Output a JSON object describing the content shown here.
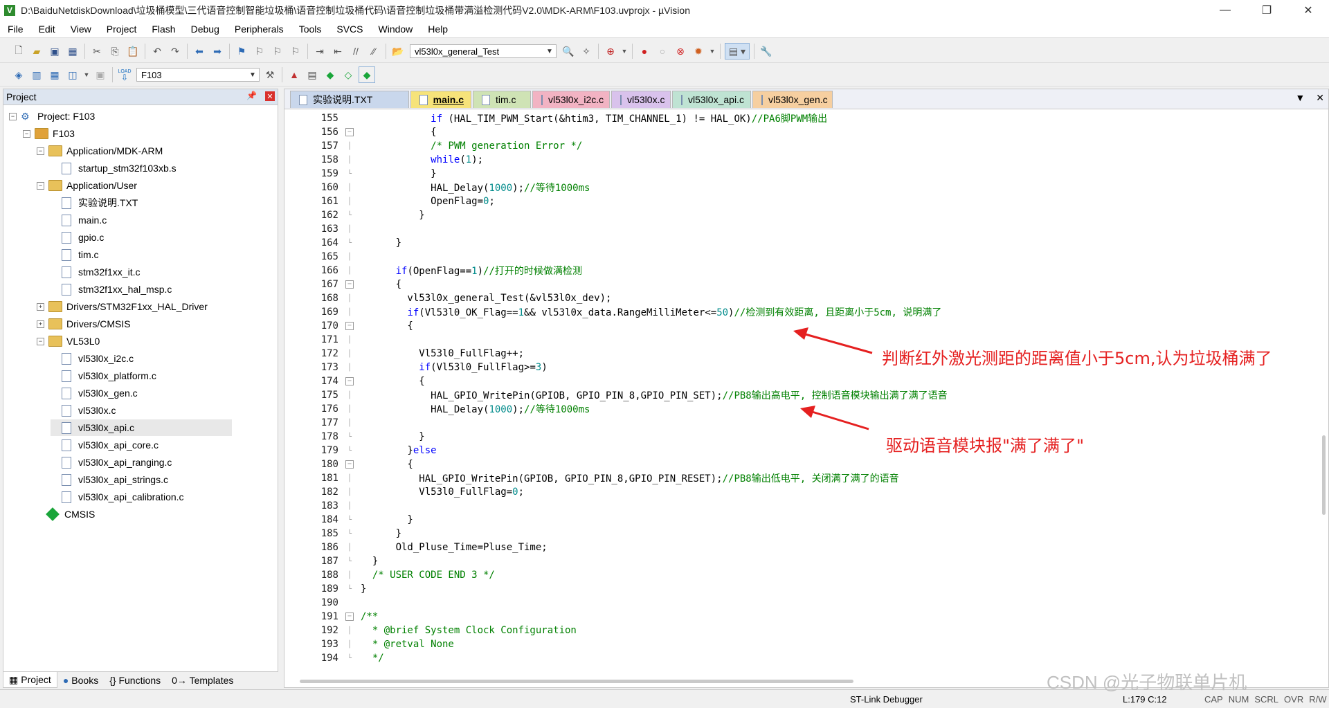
{
  "window": {
    "title": "D:\\BaiduNetdiskDownload\\垃圾桶模型\\三代语音控制智能垃圾桶\\语音控制垃圾桶代码\\语音控制垃圾桶带满溢检测代码V2.0\\MDK-ARM\\F103.uvprojx - µVision",
    "minimize": "—",
    "restore": "❐",
    "close": "✕"
  },
  "menu": [
    "File",
    "Edit",
    "View",
    "Project",
    "Flash",
    "Debug",
    "Peripherals",
    "Tools",
    "SVCS",
    "Window",
    "Help"
  ],
  "toolbar": {
    "function_combo": "vl53l0x_general_Test",
    "target_combo": "F103",
    "load_label": "LOAD"
  },
  "project_pane": {
    "title": "Project",
    "tree": [
      {
        "label": "Project: F103",
        "kind": "project",
        "level": 0,
        "expander": "−"
      },
      {
        "label": "F103",
        "kind": "target",
        "level": 1,
        "expander": "−"
      },
      {
        "label": "Application/MDK-ARM",
        "kind": "folder",
        "level": 2,
        "expander": "−"
      },
      {
        "label": "startup_stm32f103xb.s",
        "kind": "file",
        "level": 3
      },
      {
        "label": "Application/User",
        "kind": "folder",
        "level": 2,
        "expander": "−"
      },
      {
        "label": "实验说明.TXT",
        "kind": "file",
        "level": 3
      },
      {
        "label": "main.c",
        "kind": "file",
        "level": 3
      },
      {
        "label": "gpio.c",
        "kind": "file",
        "level": 3
      },
      {
        "label": "tim.c",
        "kind": "file",
        "level": 3
      },
      {
        "label": "stm32f1xx_it.c",
        "kind": "file",
        "level": 3
      },
      {
        "label": "stm32f1xx_hal_msp.c",
        "kind": "file",
        "level": 3
      },
      {
        "label": "Drivers/STM32F1xx_HAL_Driver",
        "kind": "folder",
        "level": 2,
        "expander": "+"
      },
      {
        "label": "Drivers/CMSIS",
        "kind": "folder",
        "level": 2,
        "expander": "+"
      },
      {
        "label": "VL53L0",
        "kind": "folder",
        "level": 2,
        "expander": "−"
      },
      {
        "label": "vl53l0x_i2c.c",
        "kind": "file",
        "level": 3
      },
      {
        "label": "vl53l0x_platform.c",
        "kind": "file",
        "level": 3
      },
      {
        "label": "vl53l0x_gen.c",
        "kind": "file",
        "level": 3
      },
      {
        "label": "vl53l0x.c",
        "kind": "file",
        "level": 3
      },
      {
        "label": "vl53l0x_api.c",
        "kind": "file",
        "level": 3,
        "selected": true
      },
      {
        "label": "vl53l0x_api_core.c",
        "kind": "file",
        "level": 3
      },
      {
        "label": "vl53l0x_api_ranging.c",
        "kind": "file",
        "level": 3
      },
      {
        "label": "vl53l0x_api_strings.c",
        "kind": "file",
        "level": 3
      },
      {
        "label": "vl53l0x_api_calibration.c",
        "kind": "file",
        "level": 3
      },
      {
        "label": "CMSIS",
        "kind": "cmsis",
        "level": 2
      }
    ],
    "bottom_tabs": [
      "Project",
      "Books",
      "{} Functions",
      "0→ Templates"
    ]
  },
  "editor": {
    "tabs": [
      {
        "label": "实验说明.TXT",
        "color": "#c9d7ec",
        "active": false
      },
      {
        "label": "main.c",
        "color": "#f6e37a",
        "active": true
      },
      {
        "label": "tim.c",
        "color": "#cfe3b5",
        "active": false
      },
      {
        "label": "vl53l0x_i2c.c",
        "color": "#f2b3c3",
        "active": false
      },
      {
        "label": "vl53l0x.c",
        "color": "#d9c2ec",
        "active": false
      },
      {
        "label": "vl53l0x_api.c",
        "color": "#bfe3d3",
        "active": false
      },
      {
        "label": "vl53l0x_gen.c",
        "color": "#f6cfa0",
        "active": false
      }
    ],
    "lines": [
      {
        "n": "155",
        "fold": "",
        "segs": [
          [
            "",
            "            "
          ],
          [
            "kw",
            "if"
          ],
          [
            "",
            " (HAL_TIM_PWM_Start(&htim3, TIM_CHANNEL_1) != HAL_OK)"
          ],
          [
            "cm",
            "//PA6脚PWM输出"
          ]
        ]
      },
      {
        "n": "156",
        "fold": "box",
        "segs": [
          [
            "",
            "            {"
          ]
        ]
      },
      {
        "n": "157",
        "fold": "line",
        "segs": [
          [
            "",
            "            "
          ],
          [
            "cm",
            "/* PWM generation Error */"
          ]
        ]
      },
      {
        "n": "158",
        "fold": "line",
        "segs": [
          [
            "",
            "            "
          ],
          [
            "kw",
            "while"
          ],
          [
            "",
            "("
          ],
          [
            "nm",
            "1"
          ],
          [
            "",
            ");"
          ]
        ]
      },
      {
        "n": "159",
        "fold": "end",
        "segs": [
          [
            "",
            "            }"
          ]
        ]
      },
      {
        "n": "160",
        "fold": "line",
        "segs": [
          [
            "",
            "            HAL_Delay("
          ],
          [
            "nm",
            "1000"
          ],
          [
            "",
            ");"
          ],
          [
            "cm",
            "//等待1000ms"
          ]
        ]
      },
      {
        "n": "161",
        "fold": "line",
        "segs": [
          [
            "",
            "            OpenFlag="
          ],
          [
            "nm",
            "0"
          ],
          [
            "",
            ";"
          ]
        ]
      },
      {
        "n": "162",
        "fold": "end",
        "segs": [
          [
            "",
            "          }"
          ]
        ]
      },
      {
        "n": "163",
        "fold": "line",
        "segs": [
          [
            "",
            ""
          ]
        ]
      },
      {
        "n": "164",
        "fold": "end",
        "segs": [
          [
            "",
            "      }"
          ]
        ]
      },
      {
        "n": "165",
        "fold": "line",
        "segs": [
          [
            "",
            ""
          ]
        ]
      },
      {
        "n": "166",
        "fold": "line",
        "segs": [
          [
            "",
            "      "
          ],
          [
            "kw",
            "if"
          ],
          [
            "",
            "(OpenFlag=="
          ],
          [
            "nm",
            "1"
          ],
          [
            "",
            ")"
          ],
          [
            "cm",
            "//打开的时候做满检测"
          ]
        ]
      },
      {
        "n": "167",
        "fold": "box",
        "segs": [
          [
            "",
            "      {"
          ]
        ]
      },
      {
        "n": "168",
        "fold": "line",
        "segs": [
          [
            "",
            "        vl53l0x_general_Test(&vl53l0x_dev);"
          ]
        ]
      },
      {
        "n": "169",
        "fold": "line",
        "segs": [
          [
            "",
            "        "
          ],
          [
            "kw",
            "if"
          ],
          [
            "",
            "(Vl53l0_OK_Flag=="
          ],
          [
            "nm",
            "1"
          ],
          [
            "",
            "&& vl53l0x_data.RangeMilliMeter<="
          ],
          [
            "nm",
            "50"
          ],
          [
            "",
            ")"
          ],
          [
            "cm",
            "//检测到有效距离, 且距离小于5cm, 说明满了"
          ]
        ]
      },
      {
        "n": "170",
        "fold": "box",
        "segs": [
          [
            "",
            "        {"
          ]
        ]
      },
      {
        "n": "171",
        "fold": "line",
        "segs": [
          [
            "",
            ""
          ]
        ]
      },
      {
        "n": "172",
        "fold": "line",
        "segs": [
          [
            "",
            "          Vl53l0_FullFlag++;"
          ]
        ]
      },
      {
        "n": "173",
        "fold": "line",
        "segs": [
          [
            "",
            "          "
          ],
          [
            "kw",
            "if"
          ],
          [
            "",
            "(Vl53l0_FullFlag>="
          ],
          [
            "nm",
            "3"
          ],
          [
            "",
            ")"
          ]
        ]
      },
      {
        "n": "174",
        "fold": "box",
        "segs": [
          [
            "",
            "          {"
          ]
        ]
      },
      {
        "n": "175",
        "fold": "line",
        "segs": [
          [
            "",
            "            HAL_GPIO_WritePin(GPIOB, GPIO_PIN_8,GPIO_PIN_SET);"
          ],
          [
            "cm",
            "//PB8输出高电平, 控制语音模块输出满了满了语音"
          ]
        ]
      },
      {
        "n": "176",
        "fold": "line",
        "segs": [
          [
            "",
            "            HAL_Delay("
          ],
          [
            "nm",
            "1000"
          ],
          [
            "",
            ");"
          ],
          [
            "cm",
            "//等待1000ms"
          ]
        ]
      },
      {
        "n": "177",
        "fold": "line",
        "segs": [
          [
            "",
            ""
          ]
        ]
      },
      {
        "n": "178",
        "fold": "end",
        "segs": [
          [
            "",
            "          }"
          ]
        ]
      },
      {
        "n": "179",
        "fold": "end",
        "segs": [
          [
            "",
            "        }"
          ],
          [
            "kw",
            "else"
          ]
        ]
      },
      {
        "n": "180",
        "fold": "box",
        "segs": [
          [
            "",
            "        {"
          ]
        ]
      },
      {
        "n": "181",
        "fold": "line",
        "segs": [
          [
            "",
            "          HAL_GPIO_WritePin(GPIOB, GPIO_PIN_8,GPIO_PIN_RESET);"
          ],
          [
            "cm",
            "//PB8输出低电平, 关闭满了满了的语音"
          ]
        ]
      },
      {
        "n": "182",
        "fold": "line",
        "segs": [
          [
            "",
            "          Vl53l0_FullFlag="
          ],
          [
            "nm",
            "0"
          ],
          [
            "",
            ";"
          ]
        ]
      },
      {
        "n": "183",
        "fold": "line",
        "segs": [
          [
            "",
            ""
          ]
        ]
      },
      {
        "n": "184",
        "fold": "end",
        "segs": [
          [
            "",
            "        }"
          ]
        ]
      },
      {
        "n": "185",
        "fold": "end",
        "segs": [
          [
            "",
            "      }"
          ]
        ]
      },
      {
        "n": "186",
        "fold": "line",
        "segs": [
          [
            "",
            "      Old_Pluse_Time=Pluse_Time;"
          ]
        ]
      },
      {
        "n": "187",
        "fold": "end",
        "segs": [
          [
            "",
            "  }"
          ]
        ]
      },
      {
        "n": "188",
        "fold": "line",
        "segs": [
          [
            "",
            "  "
          ],
          [
            "cm",
            "/* USER CODE END 3 */"
          ]
        ]
      },
      {
        "n": "189",
        "fold": "end",
        "segs": [
          [
            "",
            "}"
          ]
        ]
      },
      {
        "n": "190",
        "fold": "",
        "segs": [
          [
            "",
            ""
          ]
        ]
      },
      {
        "n": "191",
        "fold": "box",
        "segs": [
          [
            "cm",
            "/**"
          ]
        ]
      },
      {
        "n": "192",
        "fold": "line",
        "segs": [
          [
            "cm",
            "  * @brief System Clock Configuration"
          ]
        ]
      },
      {
        "n": "193",
        "fold": "line",
        "segs": [
          [
            "cm",
            "  * @retval None"
          ]
        ]
      },
      {
        "n": "194",
        "fold": "end",
        "segs": [
          [
            "cm",
            "  */"
          ]
        ]
      }
    ]
  },
  "annotations": [
    {
      "text": "判断红外激光测距的距离值小于5cm,认为垃圾桶满了"
    },
    {
      "text": "驱动语音模块报\"满了满了\""
    }
  ],
  "status": {
    "debugger": "ST-Link Debugger",
    "position": "L:179 C:12",
    "flags": [
      "CAP",
      "NUM",
      "SCRL",
      "OVR",
      "R/W"
    ]
  },
  "watermark": "CSDN @光子物联单片机",
  "colors": {
    "keyword": "#0000ff",
    "comment": "#008000",
    "number": "#008b8b",
    "annotation": "#e52020"
  }
}
